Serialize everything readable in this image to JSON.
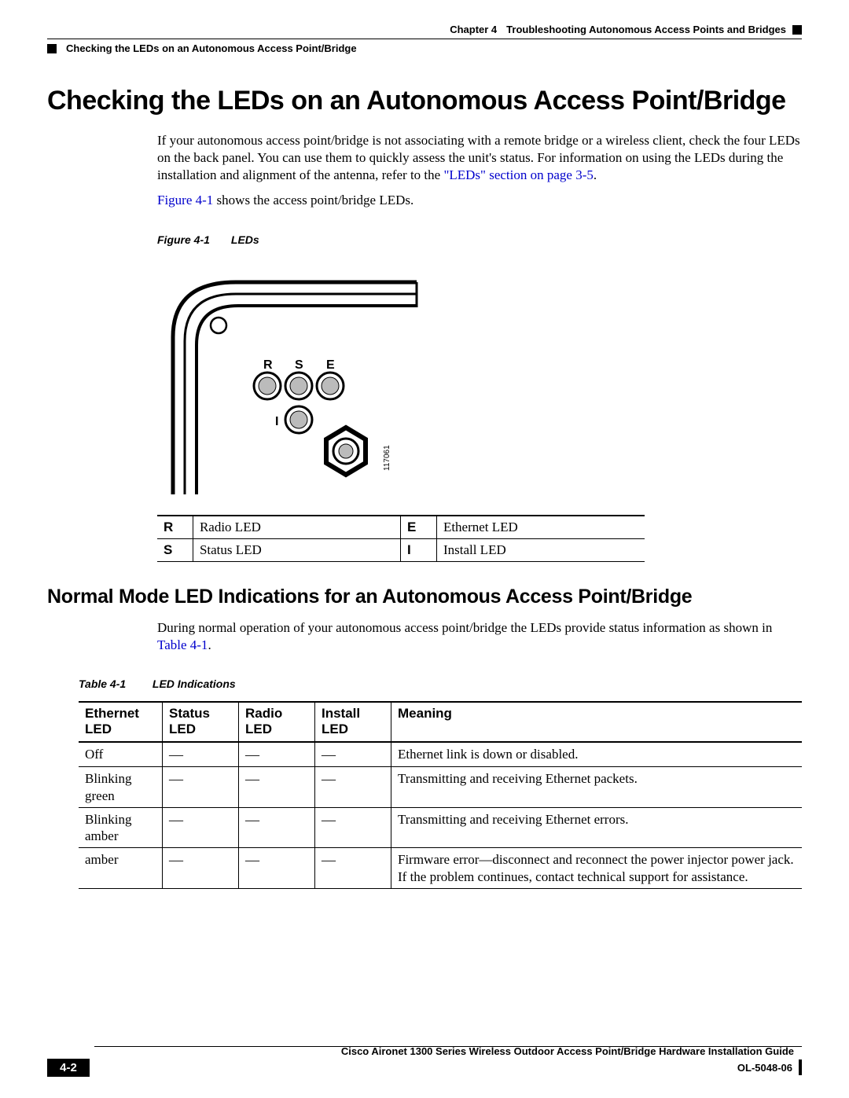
{
  "header": {
    "chapter_label": "Chapter 4",
    "chapter_title": "Troubleshooting Autonomous Access Points and Bridges",
    "section_breadcrumb": "Checking the LEDs on an Autonomous Access Point/Bridge"
  },
  "h1": "Checking the LEDs on an Autonomous Access Point/Bridge",
  "intro_para_1a": "If your autonomous access point/bridge is not associating with a remote bridge or a wireless client, check the four LEDs on the back panel. You can use them to quickly assess the unit's status. For information on using the LEDs during the installation and alignment of the antenna, refer to the ",
  "intro_link_1": "\"LEDs\" section on page 3-5",
  "intro_para_1b": ".",
  "intro_para_2a_link": "Figure 4-1",
  "intro_para_2b": " shows the access point/bridge LEDs.",
  "figure": {
    "label": "Figure 4-1",
    "title": "LEDs",
    "labels": {
      "R": "R",
      "S": "S",
      "E": "E",
      "I": "I"
    },
    "code": "117061"
  },
  "legend": {
    "r_key": "R",
    "r_val": "Radio LED",
    "e_key": "E",
    "e_val": "Ethernet LED",
    "s_key": "S",
    "s_val": "Status LED",
    "i_key": "I",
    "i_val": "Install LED"
  },
  "h2": "Normal Mode LED Indications for an Autonomous Access Point/Bridge",
  "normal_para_a": "During normal operation of your autonomous access point/bridge the LEDs provide status information as shown in ",
  "normal_link": "Table 4-1",
  "normal_para_b": ".",
  "table": {
    "label": "Table 4-1",
    "title": "LED Indications",
    "headers": {
      "eth1": "Ethernet",
      "eth2": "LED",
      "stat1": "Status",
      "stat2": "LED",
      "rad1": "Radio",
      "rad2": "LED",
      "ins1": "Install",
      "ins2": "LED",
      "mean": "Meaning"
    },
    "rows": [
      {
        "eth": "Off",
        "stat": "—",
        "rad": "—",
        "ins": "—",
        "mean": "Ethernet link is down or disabled."
      },
      {
        "eth": "Blinking green",
        "stat": "—",
        "rad": "—",
        "ins": "—",
        "mean": "Transmitting and receiving Ethernet packets."
      },
      {
        "eth": "Blinking amber",
        "stat": "—",
        "rad": "—",
        "ins": "—",
        "mean": "Transmitting and receiving Ethernet errors."
      },
      {
        "eth": "amber",
        "stat": "—",
        "rad": "—",
        "ins": "—",
        "mean": "Firmware error—disconnect and reconnect the power injector power jack. If the problem continues, contact technical support for assistance."
      }
    ]
  },
  "footer": {
    "guide_title": "Cisco Aironet 1300 Series Wireless Outdoor Access Point/Bridge Hardware Installation Guide",
    "page_number": "4-2",
    "doc_id": "OL-5048-06"
  }
}
